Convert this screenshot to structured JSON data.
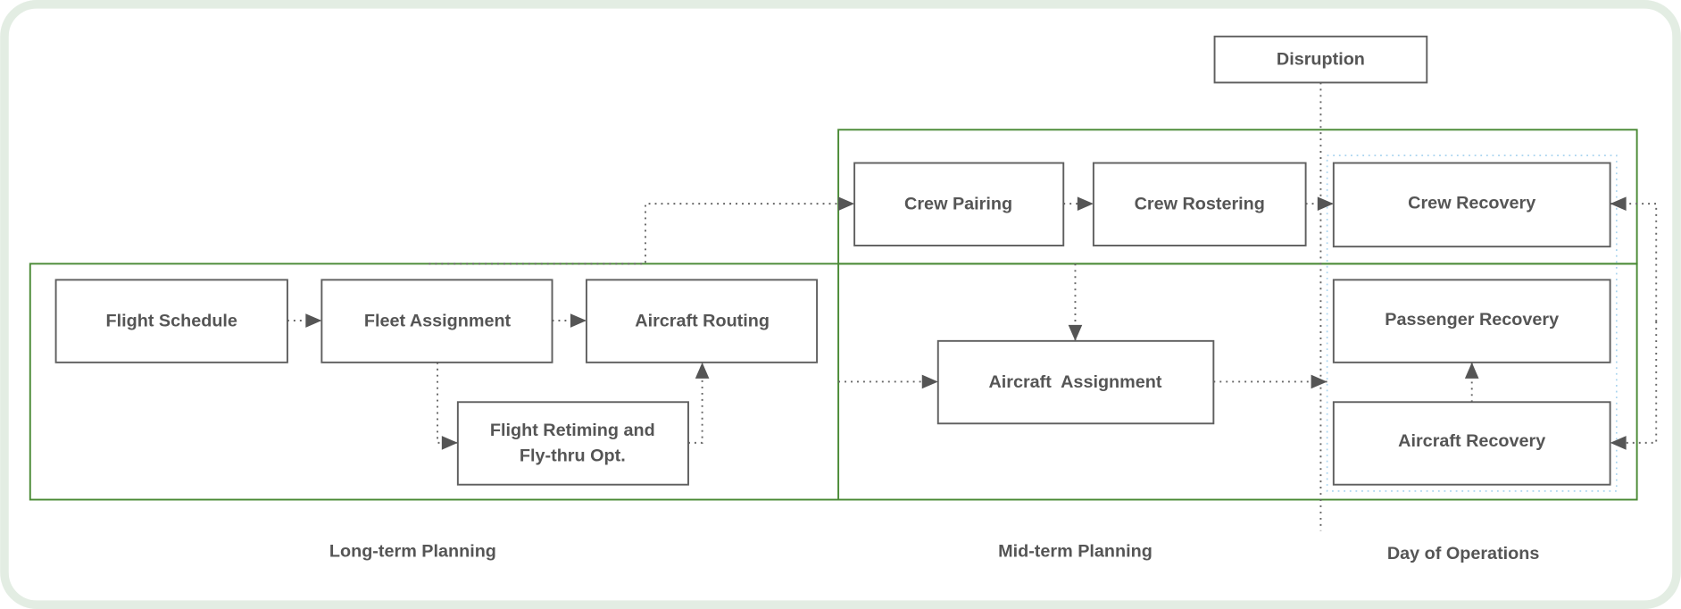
{
  "nodes": {
    "disruption": "Disruption",
    "crew_pairing": "Crew Pairing",
    "crew_rostering": "Crew Rostering",
    "crew_recovery": "Crew Recovery",
    "flight_schedule": "Flight Schedule",
    "fleet_assignment": "Fleet Assignment",
    "aircraft_routing": "Aircraft Routing",
    "flight_retiming_line1": "Flight Retiming and",
    "flight_retiming_line2": "Fly-thru Opt.",
    "aircraft_assignment": "Aircraft  Assignment",
    "passenger_recovery": "Passenger Recovery",
    "aircraft_recovery": "Aircraft Recovery"
  },
  "phases": {
    "long_term": "Long-term Planning",
    "mid_term": "Mid-term Planning",
    "day_of_ops": "Day of Operations"
  },
  "colors": {
    "frame": "#4a8a35",
    "outer_border": "#e3ede3",
    "recovery_group": "#a9d4ef",
    "box_stroke": "#5f5f5f",
    "text": "#555555"
  }
}
